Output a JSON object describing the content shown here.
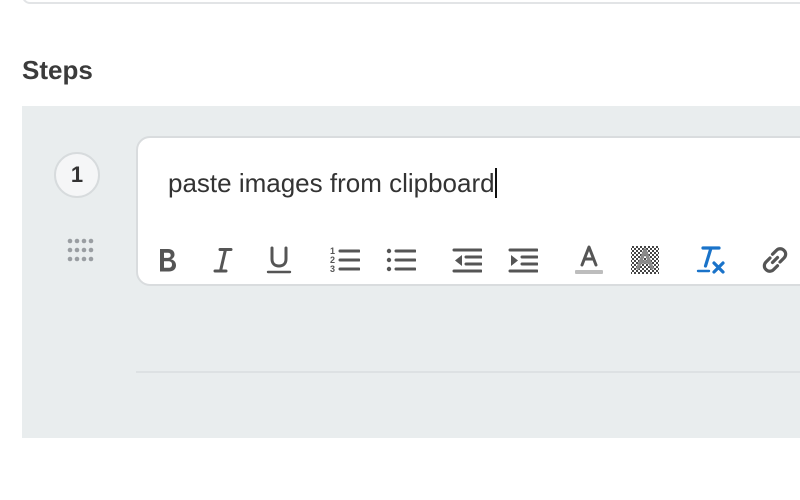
{
  "section": {
    "title": "Steps"
  },
  "steps": [
    {
      "number": "1",
      "text": "paste images from clipboard"
    }
  ],
  "toolbar": {
    "buttons": [
      {
        "name": "bold-button",
        "icon": "bold-icon"
      },
      {
        "name": "italic-button",
        "icon": "italic-icon"
      },
      {
        "name": "underline-button",
        "icon": "underline-icon"
      },
      {
        "name": "numbered-list-button",
        "icon": "numbered-list-icon"
      },
      {
        "name": "bulleted-list-button",
        "icon": "bulleted-list-icon"
      },
      {
        "name": "outdent-button",
        "icon": "outdent-icon"
      },
      {
        "name": "indent-button",
        "icon": "indent-icon"
      },
      {
        "name": "text-color-button",
        "icon": "text-color-icon"
      },
      {
        "name": "background-color-button",
        "icon": "background-color-icon"
      },
      {
        "name": "clear-formatting-button",
        "icon": "clear-formatting-icon"
      },
      {
        "name": "link-button",
        "icon": "link-icon"
      }
    ]
  },
  "colors": {
    "panel_bg": "#e9edee",
    "accent_blue": "#1a73c9",
    "icon_gray": "#555555"
  }
}
